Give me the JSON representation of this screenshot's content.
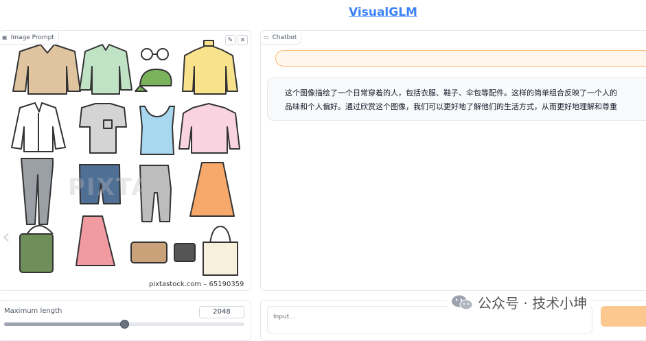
{
  "header": {
    "title": "VisualGLM"
  },
  "image_prompt": {
    "label": "Image Prompt",
    "label_icon": "image-icon",
    "edit_icon": "pencil-icon",
    "clear_icon": "close-icon",
    "watermark": "PIXTA",
    "credit": "pixtastock.com – 65190359"
  },
  "chatbot": {
    "label": "Chatbot",
    "label_icon": "chat-icon",
    "messages": [
      {
        "role": "bot",
        "line1": "这个图像描绘了一个日常穿着的人，包括衣服、鞋子、伞包等配件。这样的简单组合反映了一个人的",
        "line2": "品味和个人偏好。通过欣赏这个图像，我们可以更好地了解他们的生活方式，从而更好地理解和尊重"
      }
    ]
  },
  "controls": {
    "max_length": {
      "label": "Maximum length",
      "value": "2048",
      "fraction": 0.5
    }
  },
  "input": {
    "placeholder": "Input..."
  },
  "overlay": {
    "wechat_text": "公众号 · 技术小坤"
  },
  "colors": {
    "accent": "#3b82f6",
    "submit": "#fdba74",
    "loading": "#fff7ed"
  }
}
